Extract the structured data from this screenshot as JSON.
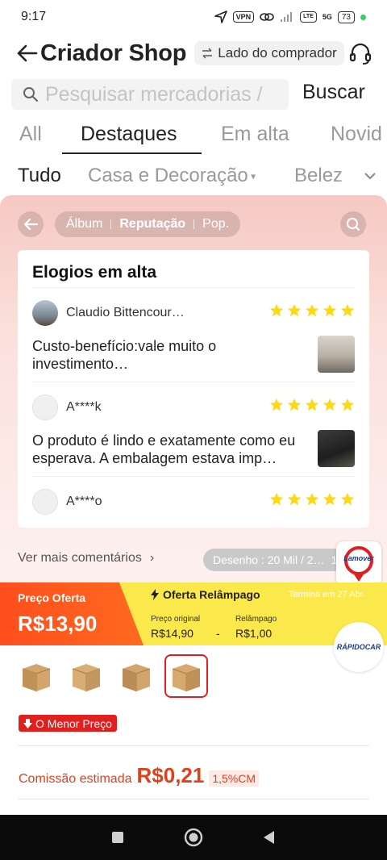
{
  "status_bar": {
    "time": "9:17",
    "vpn": "VPN",
    "net": "5G",
    "battery": "73"
  },
  "header": {
    "title": "Criador Shop",
    "mode_label": "Lado do comprador"
  },
  "search": {
    "placeholder": "Pesquisar mercadorias / ",
    "button": "Buscar"
  },
  "tabs": [
    "All",
    "Destaques",
    "Em alta",
    "Novid"
  ],
  "categories": [
    "Tudo",
    "Casa e Decoração",
    "Belez"
  ],
  "panel": {
    "segments": [
      "Álbum",
      "Reputação",
      "Pop."
    ],
    "card_title": "Elogios em alta",
    "reviews": [
      {
        "name": "Claudio Bittencour…",
        "rating": 5,
        "text": "Custo-benefício:vale muito o investimento…"
      },
      {
        "name": "A****k",
        "rating": 5,
        "text": "O produto é lindo e exatamente como eu esperava. A embalagem estava imp…"
      },
      {
        "name": "A****o",
        "rating": 5,
        "text": ""
      }
    ],
    "more_comments": "Ver mais comentários",
    "draw_label": "Desenho : 20 Mil / 2…",
    "draw_suffix": "1"
  },
  "offer": {
    "label": "Preço Oferta",
    "price": "R$13,90",
    "flash_title": "Oferta Relâmpago",
    "ends_label": "Termina em",
    "ends_date": "27 Abr.",
    "original_label": "Preço original",
    "original_value": "R$14,90",
    "dash": "-",
    "flash_label": "Relâmpago",
    "flash_value": "R$1,00"
  },
  "badges": {
    "lamover": "Lamover",
    "rapidocar": "RÁPIDOCAR"
  },
  "lowest_price": "O Menor Preço",
  "commission": {
    "label": "Comissão estimada",
    "value": "R$0,21",
    "tag": "1,5%CM"
  },
  "colors": {
    "accent": "#e0401a",
    "offer_orange": "#ff4e1e",
    "offer_yellow": "#fbe84a",
    "star": "#ffd814"
  }
}
